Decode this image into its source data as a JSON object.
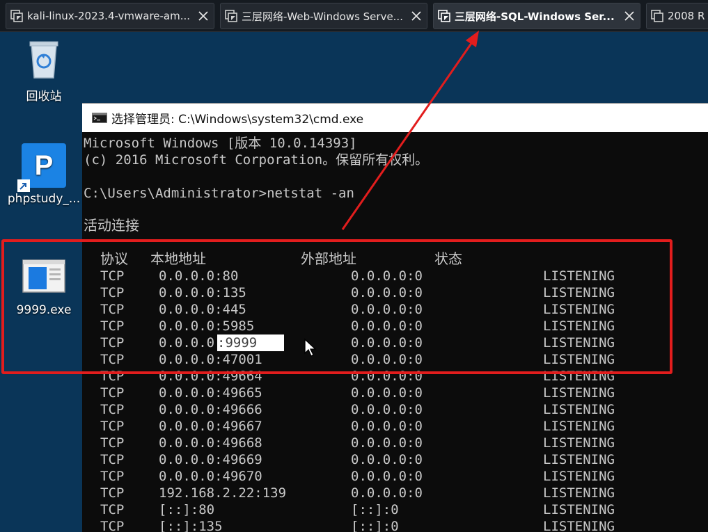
{
  "tabs": [
    {
      "label": "kali-linux-2023.4-vmware-am...",
      "active": false
    },
    {
      "label": "三层网络-Web-Windows Serve...",
      "active": false
    },
    {
      "label": "三层网络-SQL-Windows Ser...",
      "active": true
    },
    {
      "label": "2008 R",
      "active": false
    }
  ],
  "desktop": {
    "icons": [
      {
        "label": "回收站",
        "icon": "recycle-bin-icon"
      },
      {
        "label": "phpstudy_...",
        "icon": "phpstudy-icon",
        "glyph": "P"
      },
      {
        "label": "9999.exe",
        "icon": "exe-file-icon"
      }
    ]
  },
  "cmd": {
    "title": "选择管理员: C:\\Windows\\system32\\cmd.exe",
    "lines": [
      "Microsoft Windows [版本 10.0.14393]",
      "(c) 2016 Microsoft Corporation。保留所有权利。",
      "C:\\Users\\Administrator>netstat -an",
      "活动连接"
    ],
    "headers": {
      "proto": "协议",
      "local": "本地地址",
      "foreign": "外部地址",
      "state": "状态"
    },
    "rows": [
      {
        "proto": "TCP",
        "local": "0.0.0.0:80",
        "foreign": "0.0.0.0:0",
        "state": "LISTENING"
      },
      {
        "proto": "TCP",
        "local": "0.0.0.0:135",
        "foreign": "0.0.0.0:0",
        "state": "LISTENING"
      },
      {
        "proto": "TCP",
        "local": "0.0.0.0:445",
        "foreign": "0.0.0.0:0",
        "state": "LISTENING"
      },
      {
        "proto": "TCP",
        "local": "0.0.0.0:5985",
        "foreign": "0.0.0.0:0",
        "state": "LISTENING"
      },
      {
        "proto": "TCP",
        "local_prefix": "0.0.0.0",
        "local_selected": ":9999",
        "foreign": "0.0.0.0:0",
        "state": "LISTENING"
      },
      {
        "proto": "TCP",
        "local": "0.0.0.0:47001",
        "foreign": "0.0.0.0:0",
        "state": "LISTENING"
      },
      {
        "proto": "TCP",
        "local": "0.0.0.0:49664",
        "foreign": "0.0.0.0:0",
        "state": "LISTENING"
      },
      {
        "proto": "TCP",
        "local": "0.0.0.0:49665",
        "foreign": "0.0.0.0:0",
        "state": "LISTENING"
      },
      {
        "proto": "TCP",
        "local": "0.0.0.0:49666",
        "foreign": "0.0.0.0:0",
        "state": "LISTENING"
      },
      {
        "proto": "TCP",
        "local": "0.0.0.0:49667",
        "foreign": "0.0.0.0:0",
        "state": "LISTENING"
      },
      {
        "proto": "TCP",
        "local": "0.0.0.0:49668",
        "foreign": "0.0.0.0:0",
        "state": "LISTENING"
      },
      {
        "proto": "TCP",
        "local": "0.0.0.0:49669",
        "foreign": "0.0.0.0:0",
        "state": "LISTENING"
      },
      {
        "proto": "TCP",
        "local": "0.0.0.0:49670",
        "foreign": "0.0.0.0:0",
        "state": "LISTENING"
      },
      {
        "proto": "TCP",
        "local": "192.168.2.22:139",
        "foreign": "0.0.0.0:0",
        "state": "LISTENING"
      },
      {
        "proto": "TCP",
        "local": "[::]:80",
        "foreign": "[::]:0",
        "state": "LISTENING"
      },
      {
        "proto": "TCP",
        "local": "[::]:135",
        "foreign": "[::]:0",
        "state": "LISTENING"
      }
    ]
  },
  "colors": {
    "annotation": "#e21d1d",
    "console_bg": "#0c0c0c",
    "console_text": "#c8c8c8",
    "desktop_bg": "#0a3558"
  }
}
